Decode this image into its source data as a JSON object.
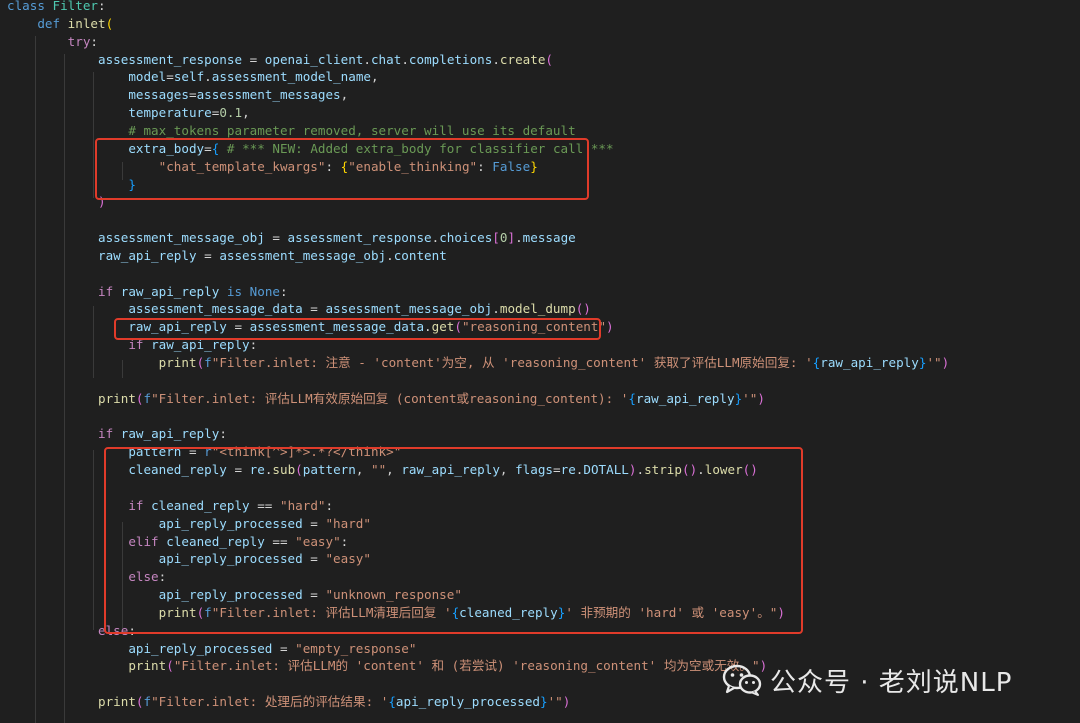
{
  "code_lines": [
    [
      [
        "kw2",
        "class "
      ],
      [
        "cls",
        "Filter"
      ],
      [
        "plain",
        ":"
      ]
    ],
    [
      [
        "kw2",
        "    def "
      ],
      [
        "fn",
        "inlet"
      ],
      [
        "br1",
        "("
      ]
    ],
    [
      [
        "kw",
        "        try"
      ],
      [
        "plain",
        ":"
      ]
    ],
    [
      [
        "var",
        "            assessment_response"
      ],
      [
        "op",
        " = "
      ],
      [
        "var",
        "openai_client"
      ],
      [
        "plain",
        "."
      ],
      [
        "var",
        "chat"
      ],
      [
        "plain",
        "."
      ],
      [
        "var",
        "completions"
      ],
      [
        "plain",
        "."
      ],
      [
        "fn",
        "create"
      ],
      [
        "br2",
        "("
      ]
    ],
    [
      [
        "var",
        "                model"
      ],
      [
        "op",
        "="
      ],
      [
        "var",
        "self"
      ],
      [
        "plain",
        "."
      ],
      [
        "var",
        "assessment_model_name"
      ],
      [
        "plain",
        ","
      ]
    ],
    [
      [
        "var",
        "                messages"
      ],
      [
        "op",
        "="
      ],
      [
        "var",
        "assessment_messages"
      ],
      [
        "plain",
        ","
      ]
    ],
    [
      [
        "var",
        "                temperature"
      ],
      [
        "op",
        "="
      ],
      [
        "num",
        "0.1"
      ],
      [
        "plain",
        ","
      ]
    ],
    [
      [
        "com",
        "                # max_tokens parameter removed, server will use its default"
      ]
    ],
    [
      [
        "var",
        "                extra_body"
      ],
      [
        "op",
        "="
      ],
      [
        "br3",
        "{"
      ],
      [
        "com",
        " # *** NEW: Added extra_body for classifier call ***"
      ]
    ],
    [
      [
        "str",
        "                    \"chat_template_kwargs\""
      ],
      [
        "plain",
        ": "
      ],
      [
        "br1",
        "{"
      ],
      [
        "str",
        "\"enable_thinking\""
      ],
      [
        "plain",
        ": "
      ],
      [
        "kw2",
        "False"
      ],
      [
        "br1",
        "}"
      ]
    ],
    [
      [
        "br3",
        "                }"
      ]
    ],
    [
      [
        "br2",
        "            )"
      ]
    ],
    [
      [
        "plain",
        ""
      ]
    ],
    [
      [
        "var",
        "            assessment_message_obj"
      ],
      [
        "op",
        " = "
      ],
      [
        "var",
        "assessment_response"
      ],
      [
        "plain",
        "."
      ],
      [
        "var",
        "choices"
      ],
      [
        "br2",
        "["
      ],
      [
        "num",
        "0"
      ],
      [
        "br2",
        "]"
      ],
      [
        "plain",
        "."
      ],
      [
        "var",
        "message"
      ]
    ],
    [
      [
        "var",
        "            raw_api_reply"
      ],
      [
        "op",
        " = "
      ],
      [
        "var",
        "assessment_message_obj"
      ],
      [
        "plain",
        "."
      ],
      [
        "var",
        "content"
      ]
    ],
    [
      [
        "plain",
        ""
      ]
    ],
    [
      [
        "kw",
        "            if "
      ],
      [
        "var",
        "raw_api_reply"
      ],
      [
        "kw2",
        " is "
      ],
      [
        "kw2",
        "None"
      ],
      [
        "plain",
        ":"
      ]
    ],
    [
      [
        "var",
        "                assessment_message_data"
      ],
      [
        "op",
        " = "
      ],
      [
        "var",
        "assessment_message_obj"
      ],
      [
        "plain",
        "."
      ],
      [
        "fn",
        "model_dump"
      ],
      [
        "br2",
        "()"
      ]
    ],
    [
      [
        "var",
        "                raw_api_reply"
      ],
      [
        "op",
        " = "
      ],
      [
        "var",
        "assessment_message_data"
      ],
      [
        "plain",
        "."
      ],
      [
        "fn",
        "get"
      ],
      [
        "br2",
        "("
      ],
      [
        "str",
        "\"reasoning_content\""
      ],
      [
        "br2",
        ")"
      ]
    ],
    [
      [
        "kw",
        "                if "
      ],
      [
        "var",
        "raw_api_reply"
      ],
      [
        "plain",
        ":"
      ]
    ],
    [
      [
        "fn",
        "                    print"
      ],
      [
        "br2",
        "("
      ],
      [
        "kw2",
        "f"
      ],
      [
        "str",
        "\"Filter.inlet: 注意 - 'content'为空, 从 'reasoning_content' 获取了评估LLM原始回复: '"
      ],
      [
        "br3",
        "{"
      ],
      [
        "var",
        "raw_api_reply"
      ],
      [
        "br3",
        "}"
      ],
      [
        "str",
        "'\""
      ],
      [
        "br2",
        ")"
      ]
    ],
    [
      [
        "plain",
        ""
      ]
    ],
    [
      [
        "fn",
        "            print"
      ],
      [
        "br2",
        "("
      ],
      [
        "kw2",
        "f"
      ],
      [
        "str",
        "\"Filter.inlet: 评估LLM有效原始回复 (content或reasoning_content): '"
      ],
      [
        "br3",
        "{"
      ],
      [
        "var",
        "raw_api_reply"
      ],
      [
        "br3",
        "}"
      ],
      [
        "str",
        "'\""
      ],
      [
        "br2",
        ")"
      ]
    ],
    [
      [
        "plain",
        ""
      ]
    ],
    [
      [
        "kw",
        "            if "
      ],
      [
        "var",
        "raw_api_reply"
      ],
      [
        "plain",
        ":"
      ]
    ],
    [
      [
        "var",
        "                pattern"
      ],
      [
        "op",
        " = "
      ],
      [
        "kw2",
        "r"
      ],
      [
        "str",
        "\"<think[^>]*>.*?</think>\""
      ]
    ],
    [
      [
        "var",
        "                cleaned_reply"
      ],
      [
        "op",
        " = "
      ],
      [
        "var",
        "re"
      ],
      [
        "plain",
        "."
      ],
      [
        "fn",
        "sub"
      ],
      [
        "br2",
        "("
      ],
      [
        "var",
        "pattern"
      ],
      [
        "plain",
        ", "
      ],
      [
        "str",
        "\"\""
      ],
      [
        "plain",
        ", "
      ],
      [
        "var",
        "raw_api_reply"
      ],
      [
        "plain",
        ", "
      ],
      [
        "var",
        "flags"
      ],
      [
        "op",
        "="
      ],
      [
        "var",
        "re"
      ],
      [
        "plain",
        "."
      ],
      [
        "var",
        "DOTALL"
      ],
      [
        "br2",
        ")"
      ],
      [
        "plain",
        "."
      ],
      [
        "fn",
        "strip"
      ],
      [
        "br2",
        "()"
      ],
      [
        "plain",
        "."
      ],
      [
        "fn",
        "lower"
      ],
      [
        "br2",
        "()"
      ]
    ],
    [
      [
        "plain",
        ""
      ]
    ],
    [
      [
        "kw",
        "                if "
      ],
      [
        "var",
        "cleaned_reply"
      ],
      [
        "op",
        " == "
      ],
      [
        "str",
        "\"hard\""
      ],
      [
        "plain",
        ":"
      ]
    ],
    [
      [
        "var",
        "                    api_reply_processed"
      ],
      [
        "op",
        " = "
      ],
      [
        "str",
        "\"hard\""
      ]
    ],
    [
      [
        "kw",
        "                elif "
      ],
      [
        "var",
        "cleaned_reply"
      ],
      [
        "op",
        " == "
      ],
      [
        "str",
        "\"easy\""
      ],
      [
        "plain",
        ":"
      ]
    ],
    [
      [
        "var",
        "                    api_reply_processed"
      ],
      [
        "op",
        " = "
      ],
      [
        "str",
        "\"easy\""
      ]
    ],
    [
      [
        "kw",
        "                else"
      ],
      [
        "plain",
        ":"
      ]
    ],
    [
      [
        "var",
        "                    api_reply_processed"
      ],
      [
        "op",
        " = "
      ],
      [
        "str",
        "\"unknown_response\""
      ]
    ],
    [
      [
        "fn",
        "                    print"
      ],
      [
        "br2",
        "("
      ],
      [
        "kw2",
        "f"
      ],
      [
        "str",
        "\"Filter.inlet: 评估LLM清理后回复 '"
      ],
      [
        "br3",
        "{"
      ],
      [
        "var",
        "cleaned_reply"
      ],
      [
        "br3",
        "}"
      ],
      [
        "str",
        "' 非预期的 'hard' 或 'easy'。\""
      ],
      [
        "br2",
        ")"
      ]
    ],
    [
      [
        "kw",
        "            else"
      ],
      [
        "plain",
        ":"
      ]
    ],
    [
      [
        "var",
        "                api_reply_processed"
      ],
      [
        "op",
        " = "
      ],
      [
        "str",
        "\"empty_response\""
      ]
    ],
    [
      [
        "fn",
        "                print"
      ],
      [
        "br2",
        "("
      ],
      [
        "str",
        "\"Filter.inlet: 评估LLM的 'content' 和 (若尝试) 'reasoning_content' 均为空或无效。\""
      ],
      [
        "br2",
        ")"
      ]
    ],
    [
      [
        "plain",
        ""
      ]
    ],
    [
      [
        "fn",
        "            print"
      ],
      [
        "br2",
        "("
      ],
      [
        "kw2",
        "f"
      ],
      [
        "str",
        "\"Filter.inlet: 处理后的评估结果: '"
      ],
      [
        "br3",
        "{"
      ],
      [
        "var",
        "api_reply_processed"
      ],
      [
        "br3",
        "}"
      ],
      [
        "str",
        "'\""
      ],
      [
        "br2",
        ")"
      ]
    ]
  ],
  "watermark": {
    "text": "公众号 · 老刘说NLP",
    "icon": "wechat-icon"
  },
  "colors": {
    "highlight_box": "#e03b2a",
    "background": "#1f1f1f"
  }
}
